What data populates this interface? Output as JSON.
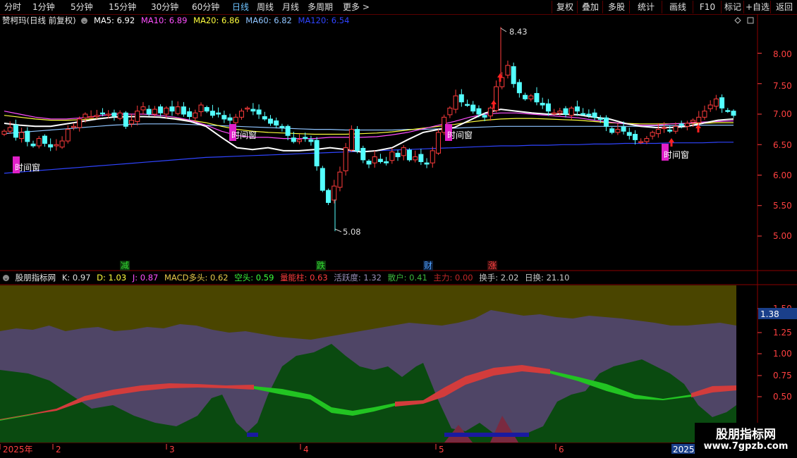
{
  "toolbar": {
    "periods": [
      "分时",
      "1分钟",
      "5分钟",
      "15分钟",
      "30分钟",
      "60分钟",
      "日线",
      "周线",
      "月线",
      "多周期",
      "更多 >"
    ],
    "active_period": "日线",
    "buttons": [
      "复权",
      "叠加",
      "多股",
      "统计",
      "画线",
      "F10",
      "标记",
      "+自选",
      "返回"
    ]
  },
  "main_chart": {
    "stock_title": "赞柯玛(日线 前复权)",
    "ma": [
      {
        "label": "MA5: 6.92",
        "color": "#ffffff"
      },
      {
        "label": "MA10: 6.89",
        "color": "#ff4fff"
      },
      {
        "label": "MA20: 6.86",
        "color": "#ffff3c"
      },
      {
        "label": "MA60: 6.82",
        "color": "#8fc4ff"
      },
      {
        "label": "MA120: 6.54",
        "color": "#2f44ff"
      }
    ],
    "price_ticks": [
      "8.00",
      "7.50",
      "7.00",
      "6.50",
      "6.00",
      "5.50",
      "5.00"
    ],
    "high_label": "8.43",
    "low_label": "5.08",
    "time_window_label": "时间窗",
    "signal_labels": {
      "jian": "减",
      "die": "跌",
      "cai": "财",
      "zhang": "涨"
    }
  },
  "indicator_panel": {
    "name": "股朋指标网",
    "values": [
      {
        "label": "K: 0.97",
        "color": "#e0e0e0"
      },
      {
        "label": "D: 1.03",
        "color": "#ffff3c"
      },
      {
        "label": "J: 0.87",
        "color": "#ff4fff"
      },
      {
        "label": "MACD多头: 0.62",
        "color": "#e6c84a"
      },
      {
        "label": "空头: 0.59",
        "color": "#3cff3c"
      },
      {
        "label": "量能柱: 0.63",
        "color": "#ff3c3c"
      },
      {
        "label": "活跃度: 1.32",
        "color": "#9a8fb8"
      },
      {
        "label": "散户: 0.41",
        "color": "#3cb83c"
      },
      {
        "label": "主力: 0.00",
        "color": "#c02828"
      },
      {
        "label": "换手: 2.02",
        "color": "#c8c8c8"
      },
      {
        "label": "日换: 21.10",
        "color": "#c8c8c8"
      }
    ],
    "ticks": [
      "1.50",
      "1.25",
      "1.00",
      "0.75",
      "0.50"
    ],
    "current_value": "1.38"
  },
  "date_axis": {
    "labels": [
      "2025年",
      "2",
      "3",
      "4",
      "5",
      "6",
      "2025/"
    ]
  },
  "watermark": {
    "line1": "股朋指标网",
    "line2": "www.7gpzb.com"
  },
  "colors": {
    "up": "#ff3c3c",
    "down": "#54ffff",
    "grid": "#8b0000",
    "axis_text": "#ff4040",
    "olive": "#4a4500",
    "purple": "#4f4566",
    "green_area": "#0a4a10",
    "red_band": "#d23c3c",
    "green_band": "#22c422"
  }
}
